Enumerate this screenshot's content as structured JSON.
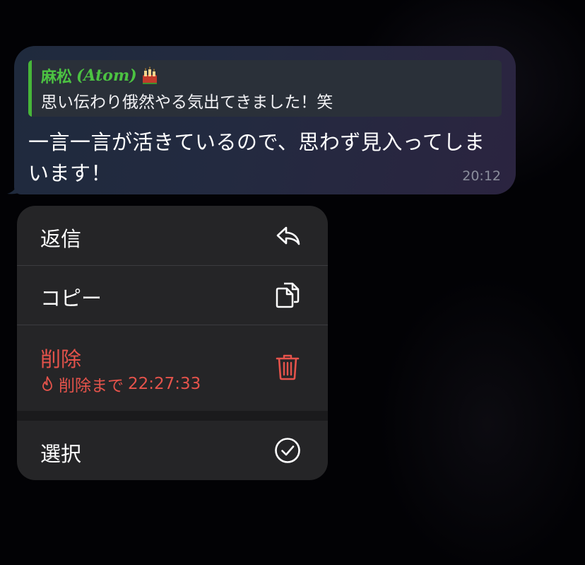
{
  "message": {
    "reply": {
      "author_name": "麻松",
      "author_tag": "(Atom)",
      "emoji_icon": "candles-emoji-icon",
      "text": "思い伝わり俄然やる気出てきました！笑"
    },
    "text": "一言一言が活きているので、思わず見入ってしまいます！",
    "time": "20:12"
  },
  "context_menu": {
    "reply": {
      "label": "返信",
      "icon": "reply-arrow-icon"
    },
    "copy": {
      "label": "コピー",
      "icon": "copy-icon"
    },
    "delete": {
      "label": "削除",
      "icon": "trash-icon",
      "countdown_label": "削除まで",
      "countdown_time": "22:27:33",
      "countdown_icon": "flame-icon"
    },
    "select": {
      "label": "選択",
      "icon": "check-circle-icon"
    }
  },
  "colors": {
    "reply_accent": "#47b639",
    "danger": "#e5534b",
    "menu_background": "#252527",
    "bubble_background": "#232a40"
  }
}
